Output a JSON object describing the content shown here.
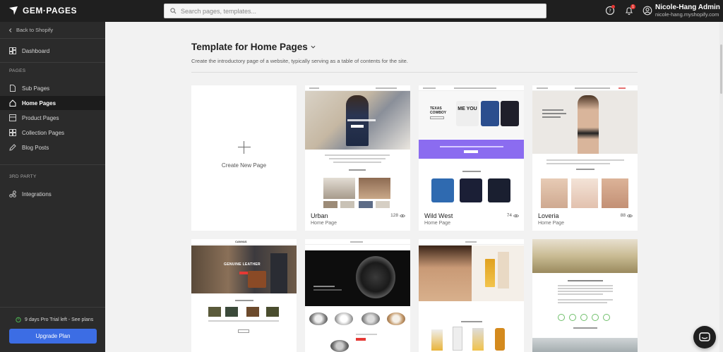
{
  "app": {
    "logo_text": "GEM·PAGES"
  },
  "search": {
    "placeholder": "Search pages, templates..."
  },
  "header": {
    "notification_count": "1",
    "user_name": "Nicole-Hang Admin",
    "user_shop": "nicole-hang.myshopify.com"
  },
  "sidebar": {
    "back_label": "Back to Shopify",
    "dashboard": "Dashboard",
    "pages_section": "PAGES",
    "items": [
      "Sub Pages",
      "Home Pages",
      "Product Pages",
      "Collection Pages",
      "Blog Posts"
    ],
    "third_party_section": "3RD PARTY",
    "integrations": "Integrations",
    "trial_text": "9 days Pro Trial left - See plans",
    "upgrade_label": "Upgrade Plan"
  },
  "main": {
    "title": "Template for Home Pages",
    "description": "Create the introductory page of a website, typically serving as a table of contents for the site.",
    "create_label": "Create New Page",
    "templates": [
      {
        "name": "Urban",
        "type": "Home Page",
        "views": "128"
      },
      {
        "name": "Wild West",
        "type": "Home Page",
        "views": "74"
      },
      {
        "name": "Loveria",
        "type": "Home Page",
        "views": "88"
      }
    ],
    "row2_thumbs": {
      "canvas_logo": "CANVAS",
      "canvas_headline": "GENUINE LEATHER",
      "texas_headline": "TEXAS COWBOY",
      "tshirt_text": "ME YOU"
    }
  },
  "colors": {
    "topbar": "#1f1f1f",
    "sidebar": "#2b2b2b",
    "accent": "#3c6de4",
    "purple_band": "#8b6cf0"
  }
}
